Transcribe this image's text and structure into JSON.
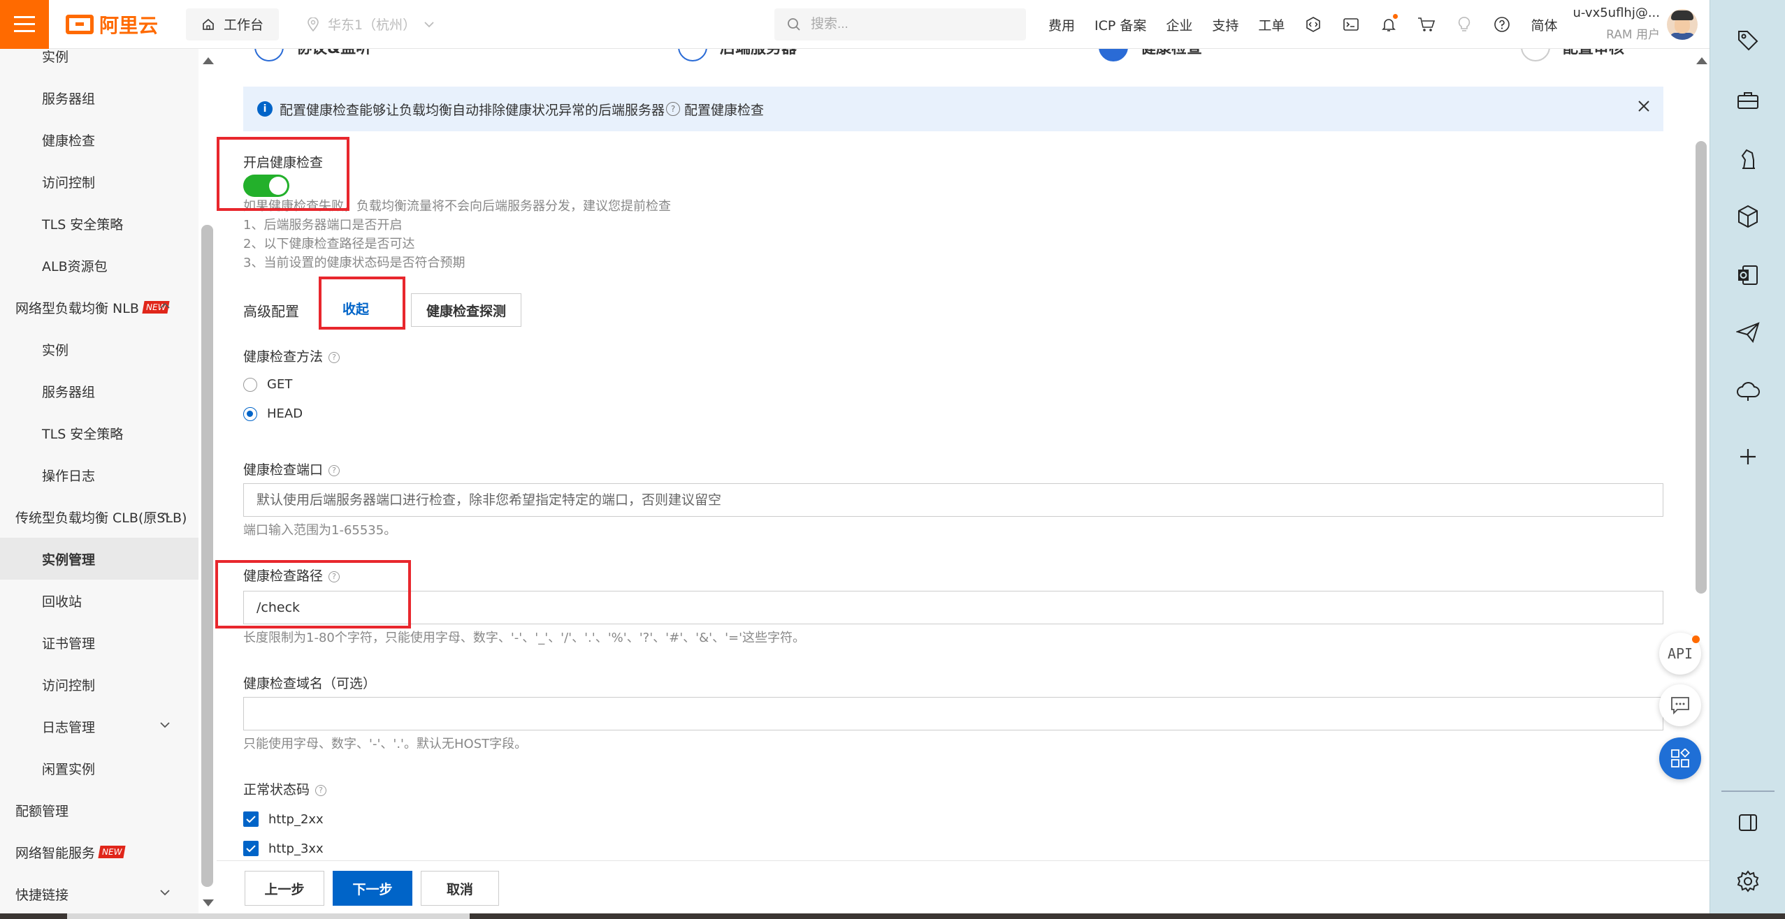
{
  "topbar": {
    "brand": "阿里云",
    "workbench": "工作台",
    "region": "华东1（杭州）",
    "search_placeholder": "搜索...",
    "nav": [
      "费用",
      "ICP 备案",
      "企业",
      "支持",
      "工单"
    ],
    "lang": "简体",
    "user_name": "u-vx5uflhj@...",
    "user_role": "RAM 用户"
  },
  "sidebar": {
    "items": [
      {
        "label": "实例",
        "type": "sub"
      },
      {
        "label": "服务器组",
        "type": "sub"
      },
      {
        "label": "健康检查",
        "type": "sub"
      },
      {
        "label": "访问控制",
        "type": "sub"
      },
      {
        "label": "TLS 安全策略",
        "type": "sub"
      },
      {
        "label": "ALB资源包",
        "type": "sub"
      },
      {
        "label": "网络型负载均衡 NLB",
        "type": "group",
        "badge": "NEW"
      },
      {
        "label": "实例",
        "type": "sub"
      },
      {
        "label": "服务器组",
        "type": "sub"
      },
      {
        "label": "TLS 安全策略",
        "type": "sub"
      },
      {
        "label": "操作日志",
        "type": "sub"
      },
      {
        "label": "传统型负载均衡 CLB(原SLB)",
        "type": "group"
      },
      {
        "label": "实例管理",
        "type": "sub",
        "active": true
      },
      {
        "label": "回收站",
        "type": "sub"
      },
      {
        "label": "证书管理",
        "type": "sub"
      },
      {
        "label": "访问控制",
        "type": "sub"
      },
      {
        "label": "日志管理",
        "type": "sub"
      },
      {
        "label": "闲置实例",
        "type": "sub"
      },
      {
        "label": "配额管理",
        "type": "group"
      },
      {
        "label": "网络智能服务",
        "type": "group",
        "badge": "NEW"
      },
      {
        "label": "快捷链接",
        "type": "group"
      }
    ]
  },
  "steps": [
    "协议&监听",
    "后端服务器",
    "健康检查",
    "配置审核"
  ],
  "banner": {
    "text": "配置健康检查能够让负载均衡自动排除健康状况异常的后端服务器",
    "link": "配置健康检查"
  },
  "form": {
    "enable_label": "开启健康检查",
    "enable_on": true,
    "enable_hints": [
      "如果健康检查失败，负载均衡流量将不会向后端服务器分发，建议您提前检查",
      "1、后端服务器端口是否开启",
      "2、以下健康检查路径是否可达",
      "3、当前设置的健康状态码是否符合预期"
    ],
    "advanced_label": "高级配置",
    "collapse_link": "收起",
    "probe_button": "健康检查探测",
    "method_label": "健康检查方法",
    "methods": [
      {
        "label": "GET",
        "selected": false
      },
      {
        "label": "HEAD",
        "selected": true
      }
    ],
    "port_label": "健康检查端口",
    "port_placeholder": "默认使用后端服务器端口进行检查，除非您希望指定特定的端口，否则建议留空",
    "port_hint": "端口输入范围为1-65535。",
    "path_label": "健康检查路径",
    "path_value": "/check",
    "path_hint": "长度限制为1-80个字符，只能使用字母、数字、'-'、'_'、'/'、'.'、'%'、'?'、'#'、'&'、'='这些字符。",
    "domain_label": "健康检查域名（可选）",
    "domain_value": "",
    "domain_hint": "只能使用字母、数字、'-'、'.'。默认无HOST字段。",
    "status_label": "正常状态码",
    "status_codes": [
      {
        "label": "http_2xx",
        "checked": true
      },
      {
        "label": "http_3xx",
        "checked": true
      }
    ]
  },
  "footer": {
    "prev": "上一步",
    "next": "下一步",
    "cancel": "取消"
  },
  "floating": {
    "api": "API"
  },
  "colors": {
    "brand": "#ff6a00",
    "primary": "#0064c8",
    "toggle_on": "#23b02b",
    "highlight": "#e8272d"
  }
}
